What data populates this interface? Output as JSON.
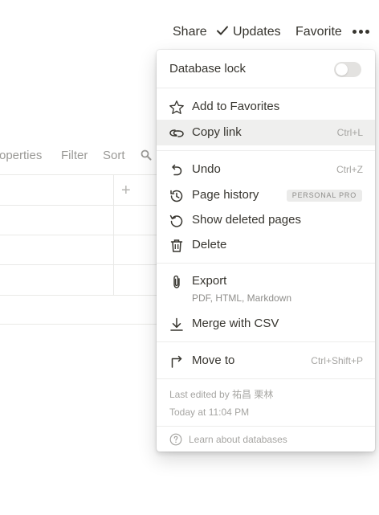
{
  "topbar": {
    "share": "Share",
    "updates": "Updates",
    "favorite": "Favorite"
  },
  "table_toolbar": {
    "properties": "roperties",
    "filter": "Filter",
    "sort": "Sort",
    "add_column": "+"
  },
  "menu": {
    "database_lock": {
      "label": "Database lock",
      "enabled": false
    },
    "add_to_favorites": "Add to Favorites",
    "copy_link": {
      "label": "Copy link",
      "shortcut": "Ctrl+L"
    },
    "undo": {
      "label": "Undo",
      "shortcut": "Ctrl+Z"
    },
    "page_history": {
      "label": "Page history",
      "badge": "PERSONAL PRO"
    },
    "show_deleted": "Show deleted pages",
    "delete": "Delete",
    "export": {
      "label": "Export",
      "sub": "PDF, HTML, Markdown"
    },
    "merge_csv": "Merge with CSV",
    "move_to": {
      "label": "Move to",
      "shortcut": "Ctrl+Shift+P"
    },
    "last_edited": "Last edited by 祐昌 栗林",
    "edited_time": "Today at 11:04 PM",
    "learn": "Learn about databases"
  },
  "colors": {
    "text": "#37352f",
    "muted": "#9b9a97",
    "hover": "#efefee",
    "toggle_off": "#e3e2e0"
  }
}
